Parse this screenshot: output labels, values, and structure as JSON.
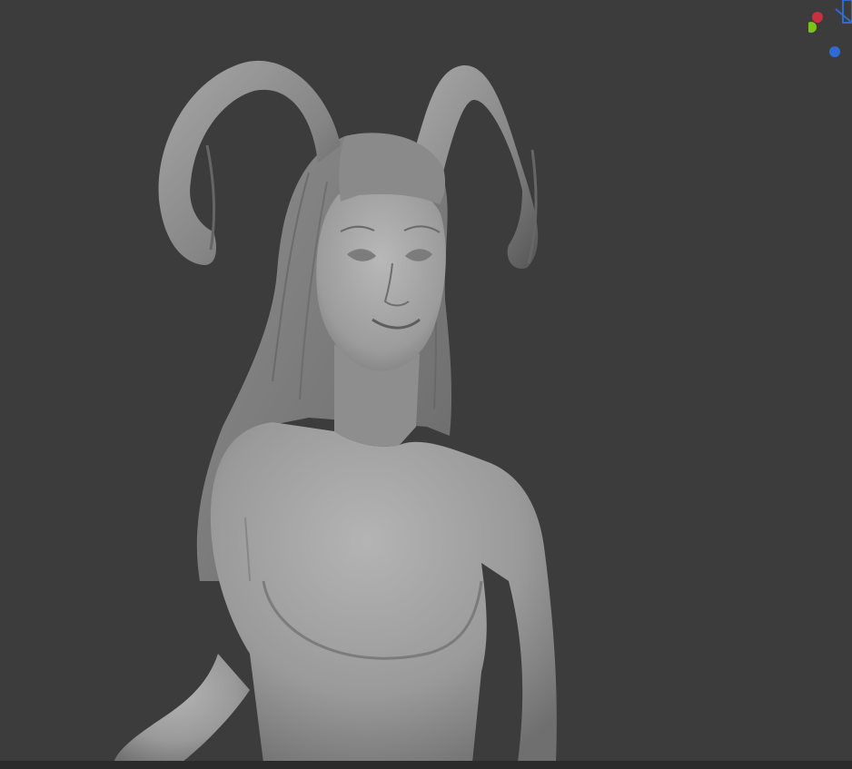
{
  "viewport": {
    "background_color": "#3c3c3c",
    "sculpt_color": "#9a9a9a",
    "model": "sculpted-female-figure-with-ram-horns"
  },
  "gizmo": {
    "axes": [
      {
        "axis": "x",
        "color": "#c8303e"
      },
      {
        "axis": "y",
        "color": "#7cc218"
      },
      {
        "axis": "z",
        "color": "#2f6bd2"
      }
    ]
  }
}
